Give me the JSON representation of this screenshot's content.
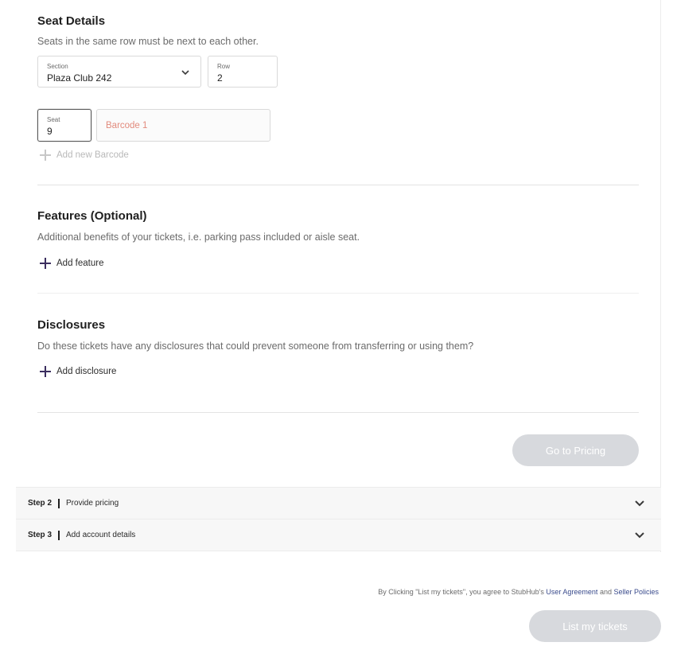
{
  "seat_details": {
    "title": "Seat Details",
    "subtitle": "Seats in the same row must be next to each other.",
    "section": {
      "label": "Section",
      "value": "Plaza Club 242"
    },
    "row": {
      "label": "Row",
      "value": "2"
    },
    "seat": {
      "label": "Seat",
      "value": "9"
    },
    "barcode": {
      "placeholder": "Barcode 1"
    },
    "add_barcode": "Add new Barcode"
  },
  "features": {
    "title": "Features (Optional)",
    "subtitle": "Additional benefits of your tickets, i.e. parking pass included or aisle seat.",
    "add_label": "Add feature"
  },
  "disclosures": {
    "title": "Disclosures",
    "subtitle": "Do these tickets have any disclosures that could prevent someone from transferring or using them?",
    "add_label": "Add disclosure"
  },
  "go_to_pricing": "Go to Pricing",
  "steps": [
    {
      "num": "Step 2",
      "label": "Provide pricing"
    },
    {
      "num": "Step 3",
      "label": "Add account details"
    }
  ],
  "agreement": {
    "prefix": "By Clicking \"List my tickets\", you agree to StubHub's ",
    "user_agreement": "User Agreement",
    "and": " and ",
    "seller_policies": "Seller Policies"
  },
  "list_button": "List my tickets",
  "colors": {
    "accent": "#3b2e5f",
    "disabled_button": "#d7d9dd",
    "link": "#3a4b8c",
    "placeholder_error": "#e28b7d"
  }
}
